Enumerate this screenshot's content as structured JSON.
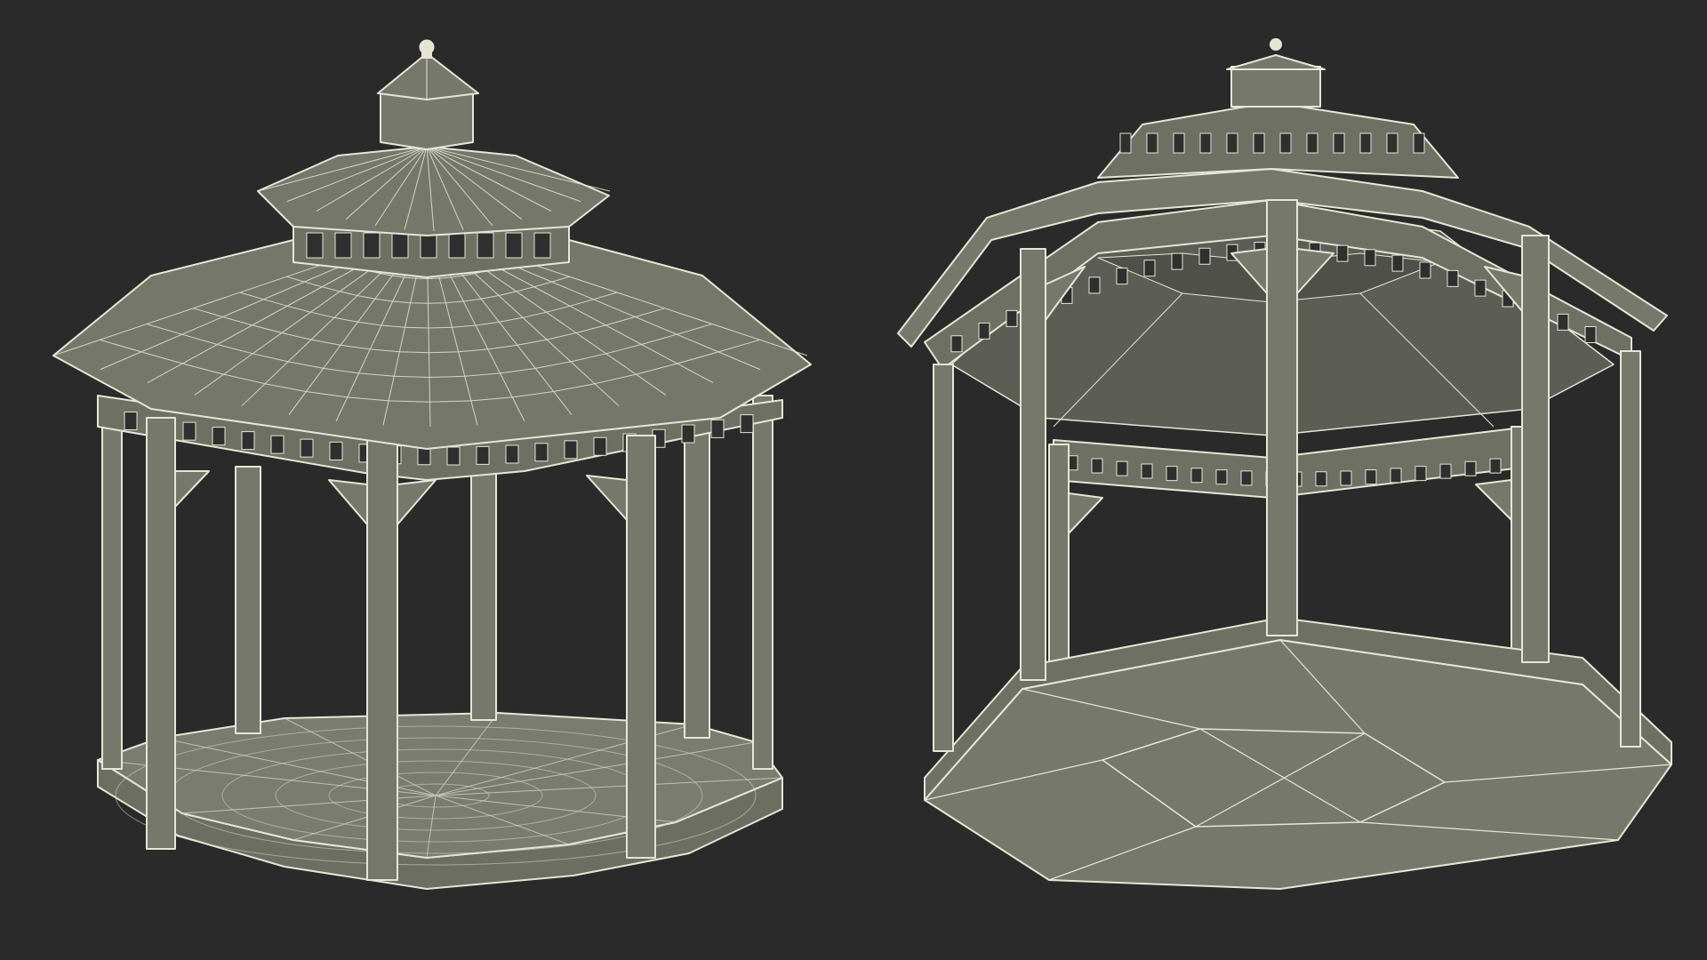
{
  "scene": {
    "background_color": "#2a2a2a",
    "model_fill_color": "#76786c",
    "wire_color": "#e6e6d6",
    "views": [
      {
        "name": "gazebo-wireframe-top-view",
        "description_icon": "gazebo-icon"
      },
      {
        "name": "gazebo-wireframe-bottom-view",
        "description_icon": "gazebo-icon"
      }
    ]
  }
}
